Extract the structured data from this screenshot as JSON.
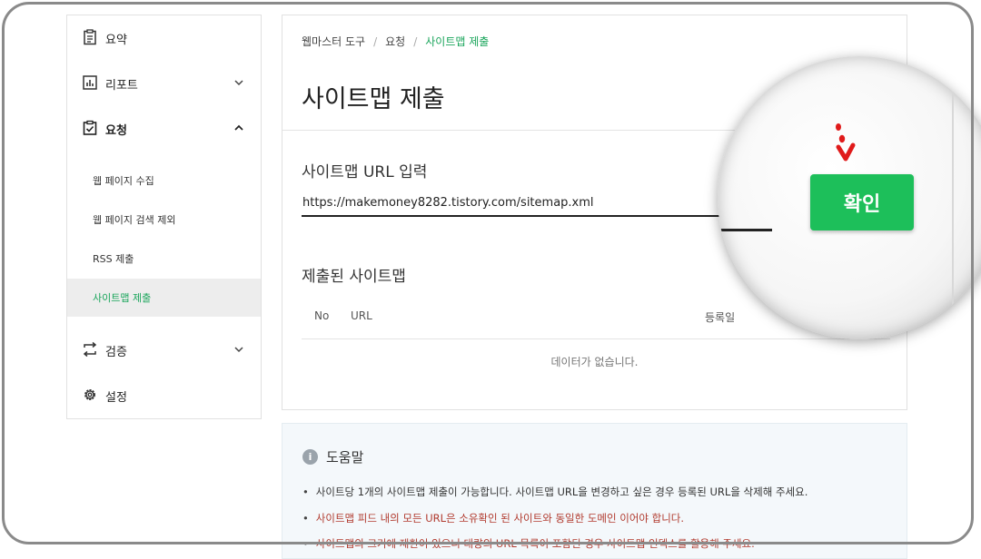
{
  "sidebar": {
    "items": [
      {
        "label": "요약",
        "icon": "summary-icon"
      },
      {
        "label": "리포트",
        "icon": "report-icon"
      },
      {
        "label": "요청",
        "icon": "request-icon"
      },
      {
        "label": "검증",
        "icon": "verify-icon"
      },
      {
        "label": "설정",
        "icon": "gear-icon"
      }
    ],
    "subitems": [
      {
        "label": "웹 페이지 수집"
      },
      {
        "label": "웹 페이지 검색 제외"
      },
      {
        "label": "RSS 제출"
      },
      {
        "label": "사이트맵 제출",
        "active": true
      }
    ]
  },
  "breadcrumb": [
    "웹마스터 도구",
    "요청",
    "사이트맵 제출"
  ],
  "breadcrumb_sep": "/",
  "page_title": "사이트맵 제출",
  "url_section": {
    "label": "사이트맵 URL 입력",
    "value": "https://makemoney8282.tistory.com/sitemap.xml",
    "button_label": "확인"
  },
  "submitted": {
    "title": "제출된 사이트맵",
    "columns": [
      "No",
      "URL",
      "등록일"
    ],
    "empty_text": "데이터가 없습니다."
  },
  "help": {
    "icon_glyph": "i",
    "title": "도움말",
    "bullets": [
      "사이트당 1개의 사이트맵 제출이 가능합니다. 사이트맵 URL을 변경하고 싶은 경우 등록된 URL을 삭제해 주세요.",
      "사이트맵 피드 내의 모든 URL은 소유확인 된 사이트와 동일한 도메인 이어야 합니다.",
      "사이트맵의 크기에 제한이 있으니 대량의 URL 목록이 포함된 경우 사이트맵 인덱스를 활용해 주세요."
    ]
  },
  "colors": {
    "accent_green": "#1aa55b",
    "button_green": "#1dbf5a",
    "help_red": "#b13a2e",
    "arrow_red": "#e01a1a"
  }
}
